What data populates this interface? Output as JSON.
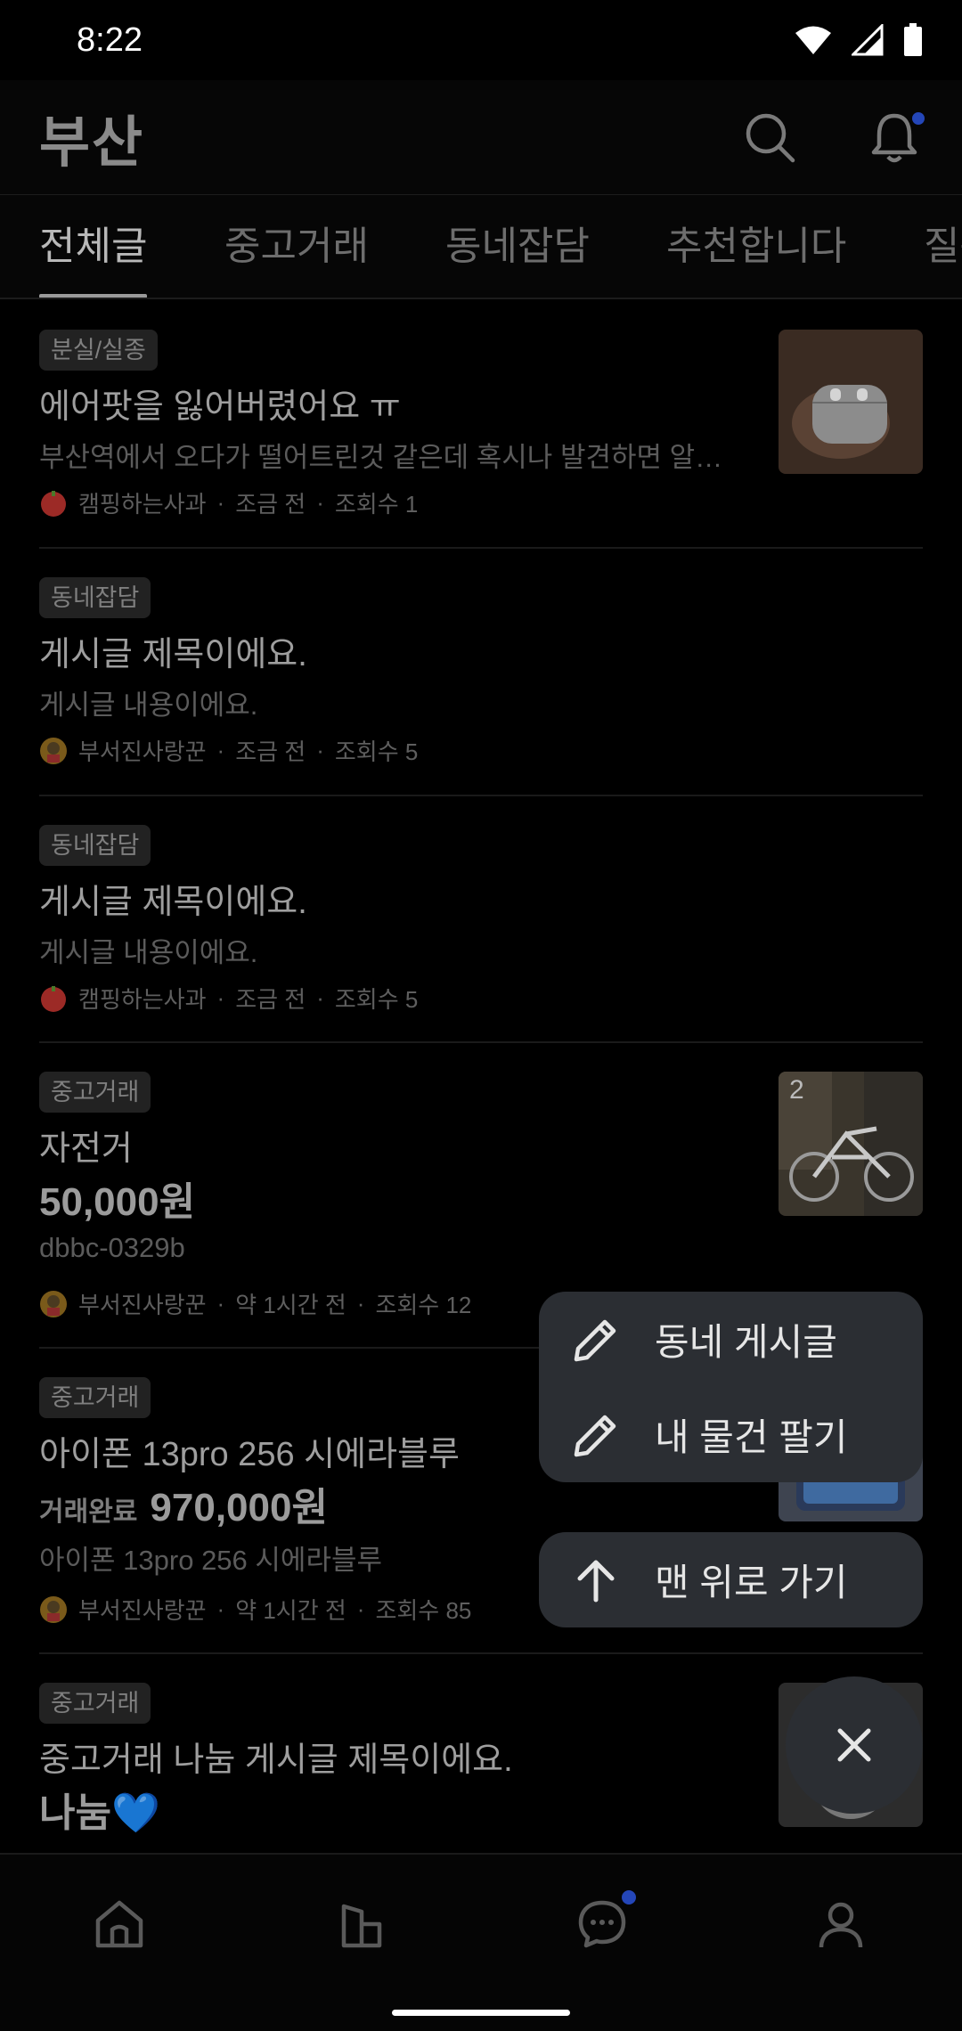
{
  "status_bar": {
    "time": "8:22"
  },
  "header": {
    "location": "부산"
  },
  "tabs": [
    {
      "label": "전체글"
    },
    {
      "label": "중고거래"
    },
    {
      "label": "동네잡담"
    },
    {
      "label": "추천합니다"
    },
    {
      "label": "질문"
    }
  ],
  "posts": [
    {
      "category": "분실/실종",
      "title": "에어팟을 잃어버렸어요 ㅠ",
      "body": "부산역에서 오다가 떨어트린것 같은데 혹시나 발견하면 알려주세요",
      "author": "캠핑하는사과",
      "time": "조금 전",
      "views": "조회수 1"
    },
    {
      "category": "동네잡담",
      "title": "게시글 제목이에요.",
      "body": "게시글 내용이에요.",
      "author": "부서진사랑꾼",
      "time": "조금 전",
      "views": "조회수 5"
    },
    {
      "category": "동네잡담",
      "title": "게시글 제목이에요.",
      "body": "게시글 내용이에요.",
      "author": "캠핑하는사과",
      "time": "조금 전",
      "views": "조회수 5"
    },
    {
      "category": "중고거래",
      "title": "자전거",
      "price": "50,000원",
      "body": "dbbc-0329b",
      "author": "부서진사랑꾼",
      "time": "약 1시간 전",
      "views": "조회수 12",
      "image_count": "2"
    },
    {
      "category": "중고거래",
      "title": "아이폰 13pro 256 시에라블루",
      "status": "거래완료",
      "price": "970,000원",
      "body": "아이폰 13pro 256 시에라블루",
      "author": "부서진사랑꾼",
      "time": "약 1시간 전",
      "views": "조회수 85"
    },
    {
      "category": "중고거래",
      "title": "중고거래 나눔 게시글 제목이에요.",
      "price": "나눔💙"
    }
  ],
  "fab_menu": {
    "items": [
      {
        "label": "동네 게시글",
        "icon": "pencil-icon"
      },
      {
        "label": "내 물건 팔기",
        "icon": "pencil-icon"
      }
    ],
    "scroll_top_label": "맨 위로 가기"
  },
  "bottom_nav": [
    "home-icon",
    "buildings-icon",
    "chat-icon",
    "profile-icon"
  ],
  "colors": {
    "accent_dot": "#2446b8",
    "fab_bg": "#2b2e33"
  }
}
